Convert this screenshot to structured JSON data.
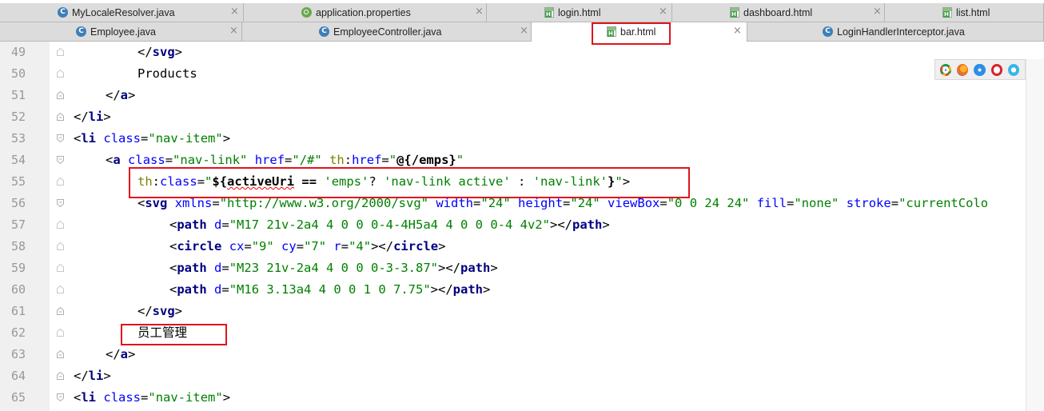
{
  "tabs_row1": [
    {
      "label": "MyLocaleResolver.java",
      "icon": "java-class-icon",
      "close": "×"
    },
    {
      "label": "application.properties",
      "icon": "spring-properties-icon",
      "close": "×"
    },
    {
      "label": "login.html",
      "icon": "html-file-icon",
      "close": "×"
    },
    {
      "label": "dashboard.html",
      "icon": "html-file-icon",
      "close": "×"
    },
    {
      "label": "list.html",
      "icon": "html-file-icon",
      "close": ""
    }
  ],
  "tabs_row2": [
    {
      "label": "Employee.java",
      "icon": "java-class-icon",
      "close": "×"
    },
    {
      "label": "EmployeeController.java",
      "icon": "java-class-icon",
      "close": "×"
    },
    {
      "label": "bar.html",
      "icon": "html-file-icon",
      "close": "×",
      "active": true
    },
    {
      "label": "LoginHandlerInterceptor.java",
      "icon": "java-class-icon",
      "close": ""
    }
  ],
  "lines": [
    {
      "num": "49",
      "indent": 2,
      "tokens": [
        [
          "t-ang",
          "</"
        ],
        [
          "t-tag",
          "svg"
        ],
        [
          "t-ang",
          ">"
        ]
      ]
    },
    {
      "num": "50",
      "indent": 2,
      "tokens": [
        [
          "t-txt",
          "Products"
        ]
      ]
    },
    {
      "num": "51",
      "indent": 1,
      "tokens": [
        [
          "t-ang",
          "</"
        ],
        [
          "t-tag",
          "a"
        ],
        [
          "t-ang",
          ">"
        ]
      ]
    },
    {
      "num": "52",
      "indent": 0,
      "tokens": [
        [
          "t-ang",
          "</"
        ],
        [
          "t-tag",
          "li"
        ],
        [
          "t-ang",
          ">"
        ]
      ]
    },
    {
      "num": "53",
      "indent": 0,
      "tokens": [
        [
          "t-ang",
          "<"
        ],
        [
          "t-tag",
          "li"
        ],
        [
          "t-txt",
          " "
        ],
        [
          "t-attr",
          "class"
        ],
        [
          "t-ang",
          "="
        ],
        [
          "t-val",
          "\"nav-item\""
        ],
        [
          "t-ang",
          ">"
        ]
      ]
    },
    {
      "num": "54",
      "indent": 1,
      "tokens": [
        [
          "t-ang",
          "<"
        ],
        [
          "t-tag",
          "a"
        ],
        [
          "t-txt",
          " "
        ],
        [
          "t-attr",
          "class"
        ],
        [
          "t-ang",
          "="
        ],
        [
          "t-val",
          "\"nav-link\""
        ],
        [
          "t-txt",
          " "
        ],
        [
          "t-attr",
          "href"
        ],
        [
          "t-ang",
          "="
        ],
        [
          "t-val",
          "\"/#\""
        ],
        [
          "t-txt",
          " "
        ],
        [
          "t-ns",
          "th"
        ],
        [
          "t-ang",
          ":"
        ],
        [
          "t-attr",
          "href"
        ],
        [
          "t-ang",
          "="
        ],
        [
          "t-val",
          "\""
        ],
        [
          "t-expr",
          "@{/emps}"
        ],
        [
          "t-val",
          "\""
        ]
      ]
    },
    {
      "num": "55",
      "indent": 2,
      "tokens": [
        [
          "t-ns",
          "th"
        ],
        [
          "t-ang",
          ":"
        ],
        [
          "t-attr",
          "class"
        ],
        [
          "t-ang",
          "="
        ],
        [
          "t-val",
          "\""
        ],
        [
          "t-expr",
          "${"
        ],
        [
          "t-expr squig",
          "activeUri"
        ],
        [
          "t-expr",
          " == "
        ],
        [
          "t-val",
          "'emps'"
        ],
        [
          "t-txt",
          "? "
        ],
        [
          "t-val",
          "'nav-link active'"
        ],
        [
          "t-txt",
          " : "
        ],
        [
          "t-val",
          "'nav-link'"
        ],
        [
          "t-expr",
          "}"
        ],
        [
          "t-val",
          "\""
        ],
        [
          "t-ang",
          ">"
        ]
      ]
    },
    {
      "num": "56",
      "indent": 2,
      "tokens": [
        [
          "t-ang",
          "<"
        ],
        [
          "t-tag",
          "svg"
        ],
        [
          "t-txt",
          " "
        ],
        [
          "t-attr",
          "xmlns"
        ],
        [
          "t-ang",
          "="
        ],
        [
          "t-val",
          "\"http://www.w3.org/2000/svg\""
        ],
        [
          "t-txt",
          " "
        ],
        [
          "t-attr",
          "width"
        ],
        [
          "t-ang",
          "="
        ],
        [
          "t-val",
          "\"24\""
        ],
        [
          "t-txt",
          " "
        ],
        [
          "t-attr",
          "height"
        ],
        [
          "t-ang",
          "="
        ],
        [
          "t-val",
          "\"24\""
        ],
        [
          "t-txt",
          " "
        ],
        [
          "t-attr",
          "viewBox"
        ],
        [
          "t-ang",
          "="
        ],
        [
          "t-val",
          "\"0 0 24 24\""
        ],
        [
          "t-txt",
          " "
        ],
        [
          "t-attr",
          "fill"
        ],
        [
          "t-ang",
          "="
        ],
        [
          "t-val",
          "\"none\""
        ],
        [
          "t-txt",
          " "
        ],
        [
          "t-attr",
          "stroke"
        ],
        [
          "t-ang",
          "="
        ],
        [
          "t-val",
          "\"currentColo"
        ]
      ]
    },
    {
      "num": "57",
      "indent": 3,
      "tokens": [
        [
          "t-ang",
          "<"
        ],
        [
          "t-tag",
          "path"
        ],
        [
          "t-txt",
          " "
        ],
        [
          "t-attr",
          "d"
        ],
        [
          "t-ang",
          "="
        ],
        [
          "t-val",
          "\"M17 21v-2a4 4 0 0 0-4-4H5a4 4 0 0 0-4 4v2\""
        ],
        [
          "t-ang",
          "></"
        ],
        [
          "t-tag",
          "path"
        ],
        [
          "t-ang",
          ">"
        ]
      ]
    },
    {
      "num": "58",
      "indent": 3,
      "tokens": [
        [
          "t-ang",
          "<"
        ],
        [
          "t-tag",
          "circle"
        ],
        [
          "t-txt",
          " "
        ],
        [
          "t-attr",
          "cx"
        ],
        [
          "t-ang",
          "="
        ],
        [
          "t-val",
          "\"9\""
        ],
        [
          "t-txt",
          " "
        ],
        [
          "t-attr",
          "cy"
        ],
        [
          "t-ang",
          "="
        ],
        [
          "t-val",
          "\"7\""
        ],
        [
          "t-txt",
          " "
        ],
        [
          "t-attr",
          "r"
        ],
        [
          "t-ang",
          "="
        ],
        [
          "t-val",
          "\"4\""
        ],
        [
          "t-ang",
          "></"
        ],
        [
          "t-tag",
          "circle"
        ],
        [
          "t-ang",
          ">"
        ]
      ]
    },
    {
      "num": "59",
      "indent": 3,
      "tokens": [
        [
          "t-ang",
          "<"
        ],
        [
          "t-tag",
          "path"
        ],
        [
          "t-txt",
          " "
        ],
        [
          "t-attr",
          "d"
        ],
        [
          "t-ang",
          "="
        ],
        [
          "t-val",
          "\"M23 21v-2a4 4 0 0 0-3-3.87\""
        ],
        [
          "t-ang",
          "></"
        ],
        [
          "t-tag",
          "path"
        ],
        [
          "t-ang",
          ">"
        ]
      ]
    },
    {
      "num": "60",
      "indent": 3,
      "tokens": [
        [
          "t-ang",
          "<"
        ],
        [
          "t-tag",
          "path"
        ],
        [
          "t-txt",
          " "
        ],
        [
          "t-attr",
          "d"
        ],
        [
          "t-ang",
          "="
        ],
        [
          "t-val",
          "\"M16 3.13a4 4 0 0 1 0 7.75\""
        ],
        [
          "t-ang",
          "></"
        ],
        [
          "t-tag",
          "path"
        ],
        [
          "t-ang",
          ">"
        ]
      ]
    },
    {
      "num": "61",
      "indent": 2,
      "tokens": [
        [
          "t-ang",
          "</"
        ],
        [
          "t-tag",
          "svg"
        ],
        [
          "t-ang",
          ">"
        ]
      ]
    },
    {
      "num": "62",
      "indent": 2,
      "tokens": [
        [
          "t-txt",
          "员工管理"
        ]
      ]
    },
    {
      "num": "63",
      "indent": 1,
      "tokens": [
        [
          "t-ang",
          "</"
        ],
        [
          "t-tag",
          "a"
        ],
        [
          "t-ang",
          ">"
        ]
      ]
    },
    {
      "num": "64",
      "indent": 0,
      "tokens": [
        [
          "t-ang",
          "</"
        ],
        [
          "t-tag",
          "li"
        ],
        [
          "t-ang",
          ">"
        ]
      ]
    },
    {
      "num": "65",
      "indent": 0,
      "tokens": [
        [
          "t-ang",
          "<"
        ],
        [
          "t-tag",
          "li"
        ],
        [
          "t-txt",
          " "
        ],
        [
          "t-attr",
          "class"
        ],
        [
          "t-ang",
          "="
        ],
        [
          "t-val",
          "\"nav-item\""
        ],
        [
          "t-ang",
          ">"
        ]
      ]
    }
  ],
  "browser_icons": [
    {
      "name": "chrome-icon",
      "color": "#e4452f"
    },
    {
      "name": "firefox-icon",
      "color": "#e8712b"
    },
    {
      "name": "safari-icon",
      "color": "#2f8de4"
    },
    {
      "name": "opera-icon",
      "color": "#d9232b"
    },
    {
      "name": "ie-icon",
      "color": "#38b6e8"
    }
  ],
  "colors": {
    "highlight_box": "#e0141e",
    "tag": "#000080",
    "attribute": "#0000ff",
    "string": "#008000",
    "namespace": "#808000"
  }
}
